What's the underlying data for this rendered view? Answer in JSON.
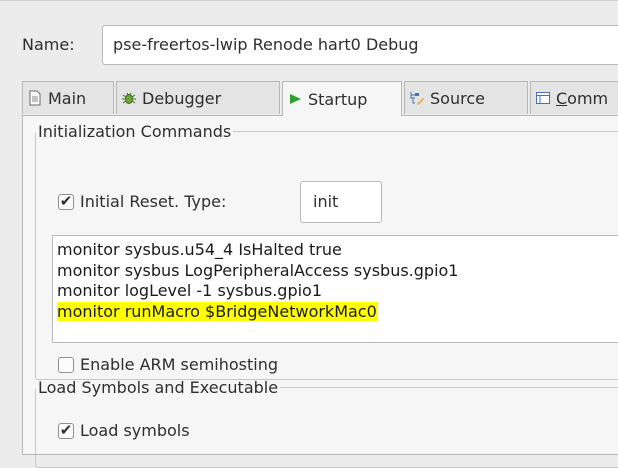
{
  "name": {
    "label": "Name:",
    "value": "pse-freertos-lwip Renode hart0 Debug"
  },
  "tabs": [
    {
      "label": "Main",
      "icon": "document-icon",
      "active": false
    },
    {
      "label": "Debugger",
      "icon": "bug-icon",
      "active": false
    },
    {
      "label": "Startup",
      "icon": "play-icon",
      "active": true
    },
    {
      "label": "Source",
      "icon": "source-lookup-icon",
      "active": false
    },
    {
      "label_first": "C",
      "label_rest": "omm",
      "icon": "common-icon",
      "active": false
    }
  ],
  "init": {
    "legend": "Initialization Commands",
    "reset_label": "Initial Reset. Type:",
    "reset_checked": true,
    "reset_type": "init",
    "commands": [
      "monitor sysbus.u54_4 IsHalted true",
      "monitor sysbus LogPeripheralAccess sysbus.gpio1",
      "monitor logLevel -1 sysbus.gpio1",
      "monitor runMacro $BridgeNetworkMac0"
    ],
    "highlight_color": "#ffff00",
    "semihosting_label": "Enable ARM semihosting",
    "semihosting_checked": false
  },
  "load": {
    "legend": "Load Symbols and Executable",
    "symbols_label": "Load symbols",
    "symbols_checked": true
  },
  "colors": {
    "background": "#ececec",
    "panel": "#f6f6f6",
    "play_green": "#2e9e2e"
  }
}
